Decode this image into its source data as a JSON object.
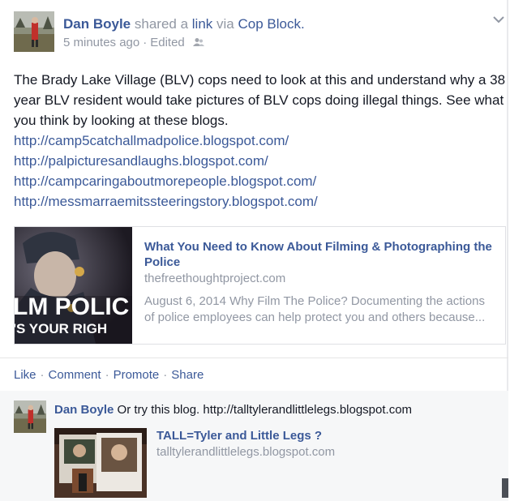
{
  "post": {
    "author": "Dan Boyle",
    "shared_text": "shared a",
    "link_word": "link",
    "via_text": "via",
    "source_page": "Cop Block.",
    "time": "5 minutes ago",
    "separator": "·",
    "edited": "Edited",
    "audience_icon": "friends-audience-icon",
    "menu_icon": "chevron-down-icon",
    "message": "The Brady Lake Village (BLV) cops need to look at this and understand why a 38 year BLV resident would take pictures of BLV cops doing illegal things. See what you think by looking at these blogs.",
    "urls": [
      "http://camp5catchallmadpolice.blogspot.com/",
      "http://palpicturesandlaughs.blogspot.com/",
      "http://campcaringaboutmorepeople.blogspot.com/",
      "http://messmarraemitssteeringstory.blogspot.com/"
    ]
  },
  "shared_link": {
    "title": "What You Need to Know About Filming & Photographing the Police",
    "domain": "thefreethoughtproject.com",
    "description": "August 6, 2014 Why Film The Police? Documenting the actions of police employees can help protect you and others because...",
    "image_text_line1": "LM POLIC",
    "image_text_line2": "'S YOUR RIGH"
  },
  "actions": {
    "like": "Like",
    "comment": "Comment",
    "promote": "Promote",
    "share": "Share",
    "separator": "·"
  },
  "comment": {
    "author": "Dan Boyle",
    "text": "Or try this blog. http://talltylerandlittlelegs.blogspot.com",
    "link_title": "TALL=Tyler and Little Legs ?",
    "link_domain": "talltylerandlittlelegs.blogspot.com"
  },
  "colors": {
    "link_blue": "#3b5998",
    "meta_grey": "#9197a3",
    "text_dark": "#141823",
    "comment_bg": "#f6f7f8"
  }
}
